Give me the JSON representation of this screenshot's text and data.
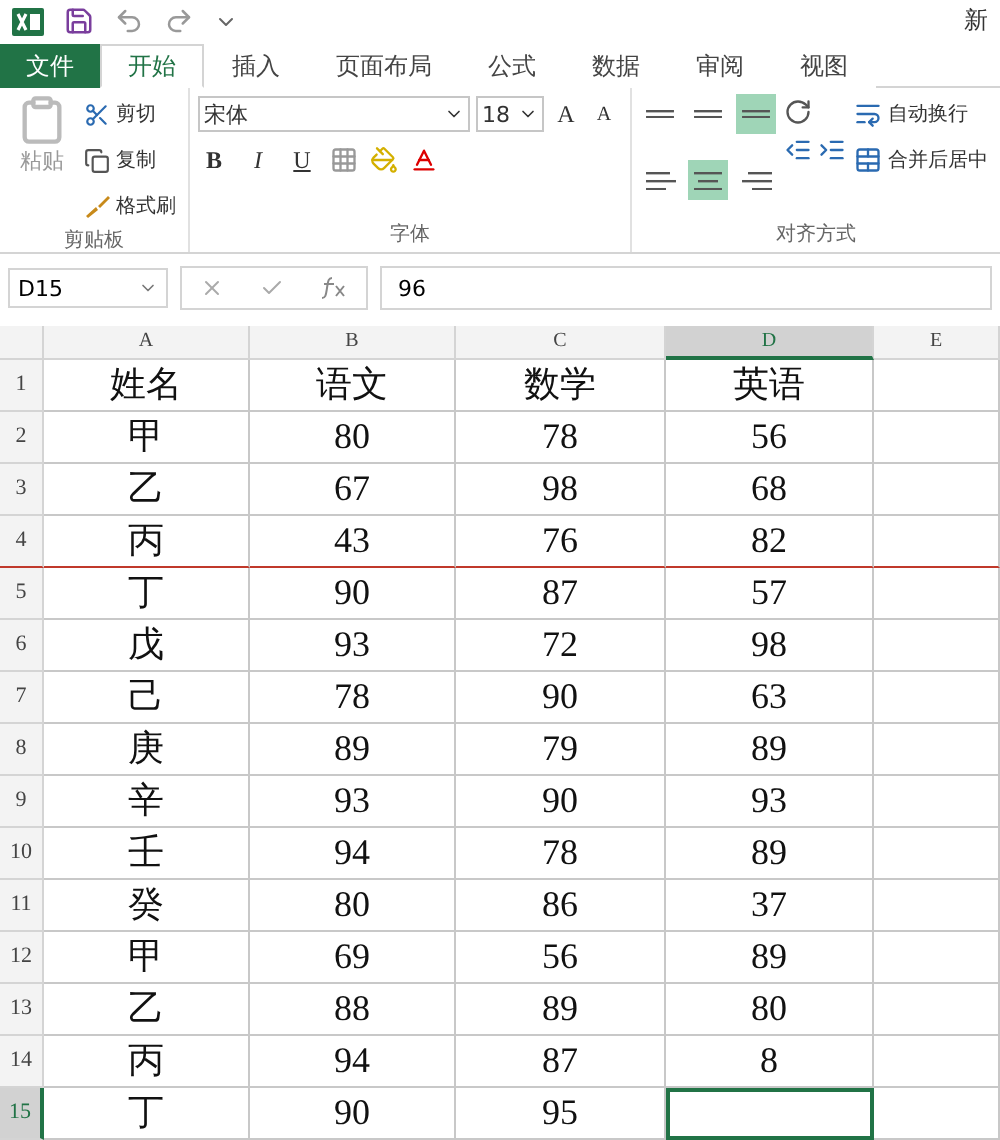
{
  "window": {
    "title": "新"
  },
  "tabs": [
    {
      "label": "文件",
      "kind": "file",
      "selected": false
    },
    {
      "label": "开始",
      "kind": "tab",
      "selected": true
    },
    {
      "label": "插入",
      "kind": "tab",
      "selected": false
    },
    {
      "label": "页面布局",
      "kind": "tab",
      "selected": false
    },
    {
      "label": "公式",
      "kind": "tab",
      "selected": false
    },
    {
      "label": "数据",
      "kind": "tab",
      "selected": false
    },
    {
      "label": "审阅",
      "kind": "tab",
      "selected": false
    },
    {
      "label": "视图",
      "kind": "tab",
      "selected": false
    }
  ],
  "ribbon": {
    "clipboard": {
      "paste": "粘贴",
      "cut": "剪切",
      "copy": "复制",
      "format_painter": "格式刷",
      "group_label": "剪贴板"
    },
    "font": {
      "name": "宋体",
      "size": "18",
      "bold": "B",
      "italic": "I",
      "underline": "U",
      "grow": "A",
      "shrink": "A",
      "group_label": "字体"
    },
    "alignment": {
      "buttons": [
        {
          "kind": "top",
          "selected": false
        },
        {
          "kind": "middle",
          "selected": false
        },
        {
          "kind": "bottom",
          "selected": true
        },
        {
          "kind": "left",
          "selected": false
        },
        {
          "kind": "center",
          "selected": true
        },
        {
          "kind": "right",
          "selected": false
        }
      ],
      "wrap_text": "自动换行",
      "merge_center": "合并后居中",
      "group_label": "对齐方式"
    }
  },
  "formula_bar": {
    "name_box": "D15",
    "formula": "96"
  },
  "sheet": {
    "columns": [
      {
        "label": "A",
        "selected": false
      },
      {
        "label": "B",
        "selected": false
      },
      {
        "label": "C",
        "selected": false
      },
      {
        "label": "D",
        "selected": true
      },
      {
        "label": "E",
        "selected": false
      }
    ],
    "rows": [
      {
        "number": "1",
        "selected": false,
        "page_break": false,
        "cells": [
          "姓名",
          "语文",
          "数学",
          "英语"
        ]
      },
      {
        "number": "2",
        "selected": false,
        "page_break": false,
        "cells": [
          "甲",
          "80",
          "78",
          "56"
        ]
      },
      {
        "number": "3",
        "selected": false,
        "page_break": false,
        "cells": [
          "乙",
          "67",
          "98",
          "68"
        ]
      },
      {
        "number": "4",
        "selected": false,
        "page_break": true,
        "cells": [
          "丙",
          "43",
          "76",
          "82"
        ]
      },
      {
        "number": "5",
        "selected": false,
        "page_break": false,
        "cells": [
          "丁",
          "90",
          "87",
          "57"
        ]
      },
      {
        "number": "6",
        "selected": false,
        "page_break": false,
        "cells": [
          "戊",
          "93",
          "72",
          "98"
        ]
      },
      {
        "number": "7",
        "selected": false,
        "page_break": false,
        "cells": [
          "己",
          "78",
          "90",
          "63"
        ]
      },
      {
        "number": "8",
        "selected": false,
        "page_break": false,
        "cells": [
          "庚",
          "89",
          "79",
          "89"
        ]
      },
      {
        "number": "9",
        "selected": false,
        "page_break": false,
        "cells": [
          "辛",
          "93",
          "90",
          "93"
        ]
      },
      {
        "number": "10",
        "selected": false,
        "page_break": false,
        "cells": [
          "壬",
          "94",
          "78",
          "89"
        ]
      },
      {
        "number": "11",
        "selected": false,
        "page_break": false,
        "cells": [
          "癸",
          "80",
          "86",
          "37"
        ]
      },
      {
        "number": "12",
        "selected": false,
        "page_break": false,
        "cells": [
          "甲",
          "69",
          "56",
          "89"
        ]
      },
      {
        "number": "13",
        "selected": false,
        "page_break": false,
        "cells": [
          "乙",
          "88",
          "89",
          "80"
        ]
      },
      {
        "number": "14",
        "selected": false,
        "page_break": false,
        "cells": [
          "丙",
          "94",
          "87",
          "8"
        ]
      },
      {
        "number": "15",
        "selected": true,
        "page_break": false,
        "cells": [
          "丁",
          "90",
          "95"
        ]
      }
    ]
  }
}
